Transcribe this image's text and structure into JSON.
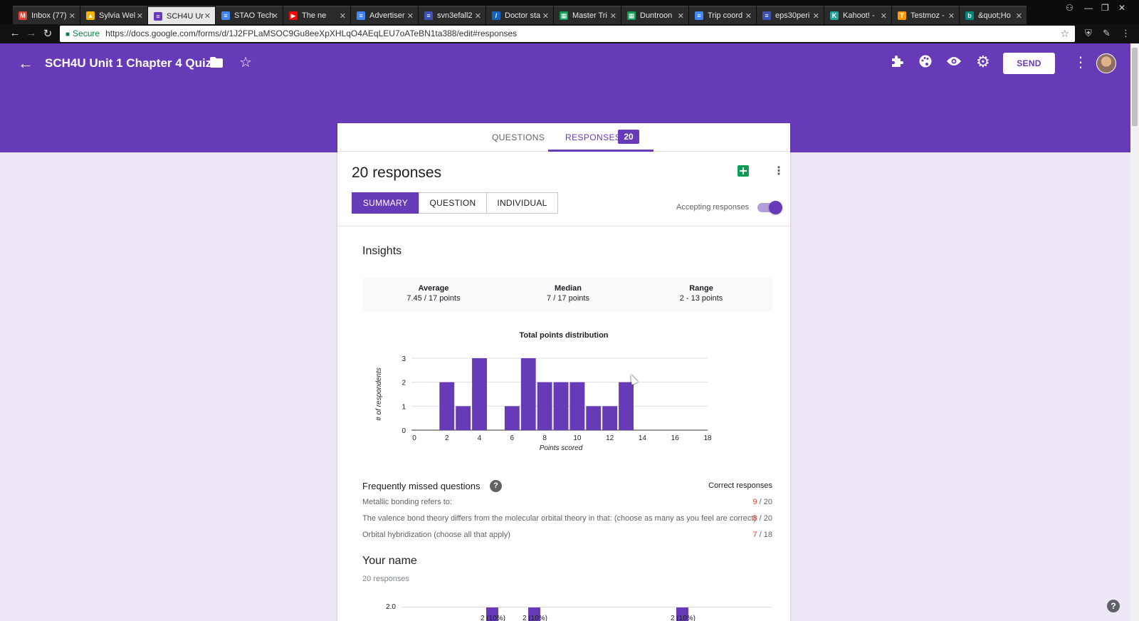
{
  "browser": {
    "tabs": [
      {
        "label": "Inbox (77)",
        "icon": "gmail-icon",
        "color": "#db4437",
        "glyph": "M",
        "active": false
      },
      {
        "label": "Sylvia Wel",
        "icon": "drive-icon",
        "color": "#f4b400",
        "glyph": "▲",
        "active": false
      },
      {
        "label": "SCH4U Ur",
        "icon": "forms-icon",
        "color": "#673ab7",
        "glyph": "≡",
        "active": true
      },
      {
        "label": "STAO Tech",
        "icon": "docs-icon",
        "color": "#4285f4",
        "glyph": "≡",
        "active": false
      },
      {
        "label": "The ne",
        "icon": "youtube-icon",
        "color": "#ff0000",
        "glyph": "▶",
        "active": false
      },
      {
        "label": "Advertiser",
        "icon": "docs-icon",
        "color": "#4285f4",
        "glyph": "≡",
        "active": false
      },
      {
        "label": "svn3efall2",
        "icon": "forms-icon",
        "color": "#3f51b5",
        "glyph": "≡",
        "active": false
      },
      {
        "label": "Doctor sta",
        "icon": "slash-icon",
        "color": "#1565c0",
        "glyph": "/",
        "active": false
      },
      {
        "label": "Master Tri",
        "icon": "sheets-icon",
        "color": "#0f9d58",
        "glyph": "▦",
        "active": false
      },
      {
        "label": "Duntroon",
        "icon": "sheets-icon",
        "color": "#0f9d58",
        "glyph": "▦",
        "active": false
      },
      {
        "label": "Trip coord",
        "icon": "docs-icon",
        "color": "#4285f4",
        "glyph": "≡",
        "active": false
      },
      {
        "label": "eps30peri",
        "icon": "forms-icon",
        "color": "#3f51b5",
        "glyph": "≡",
        "active": false
      },
      {
        "label": "Kahoot! -",
        "icon": "kahoot-icon",
        "color": "#26a69a",
        "glyph": "K",
        "active": false
      },
      {
        "label": "Testmoz -",
        "icon": "testmoz-icon",
        "color": "#ff9800",
        "glyph": "T",
        "active": false
      },
      {
        "label": "&quot;Ho",
        "icon": "bing-icon",
        "color": "#00897b",
        "glyph": "b",
        "active": false
      }
    ],
    "secure_label": "Secure",
    "url": "https://docs.google.com/forms/d/1J2FPLaMSOC9Gu8eeXpXHLqO4AEqLEU7oATeBN1ta388/edit#responses"
  },
  "form": {
    "title": "SCH4U Unit 1 Chapter 4 Quiz",
    "send_label": "SEND",
    "tab_questions": "QUESTIONS",
    "tab_responses": "RESPONSES",
    "responses_badge": "20",
    "response_count_title": "20 responses",
    "view_summary": "SUMMARY",
    "view_question": "QUESTION",
    "view_individual": "INDIVIDUAL",
    "accepting_label": "Accepting responses",
    "accepting": true
  },
  "insights": {
    "title": "Insights",
    "average_label": "Average",
    "average_value": "7.45 / 17 points",
    "median_label": "Median",
    "median_value": "7 / 17 points",
    "range_label": "Range",
    "range_value": "2 - 13 points"
  },
  "chart_data": {
    "type": "bar",
    "title": "Total points distribution",
    "xlabel": "Points scored",
    "ylabel": "# of respondents",
    "x": [
      2,
      3,
      4,
      6,
      7,
      8,
      9,
      10,
      11,
      12,
      13
    ],
    "values": [
      2,
      1,
      3,
      1,
      3,
      2,
      2,
      2,
      1,
      1,
      2
    ],
    "xlim": [
      0,
      18
    ],
    "ylim": [
      0,
      3
    ],
    "xticks": [
      0,
      2,
      4,
      6,
      8,
      10,
      12,
      14,
      16,
      18
    ],
    "yticks": [
      0,
      1,
      2,
      3
    ],
    "color": "#673ab7",
    "grid": true
  },
  "missed": {
    "title": "Frequently missed questions",
    "correct_header": "Correct responses",
    "items": [
      {
        "question": "Metallic bonding refers to:",
        "correct": "9",
        "total": " / 20"
      },
      {
        "question": "The valence bond theory differs from the molecular orbital theory in that: (choose as many as you feel are correct)",
        "correct": "8",
        "total": " / 20"
      },
      {
        "question": "Orbital hybridization (choose all that apply)",
        "correct": "7",
        "total": " / 18"
      }
    ]
  },
  "your_name": {
    "title": "Your name",
    "count": "20 responses",
    "axis_top": "2.0",
    "bar_label": "2 (10%)"
  }
}
